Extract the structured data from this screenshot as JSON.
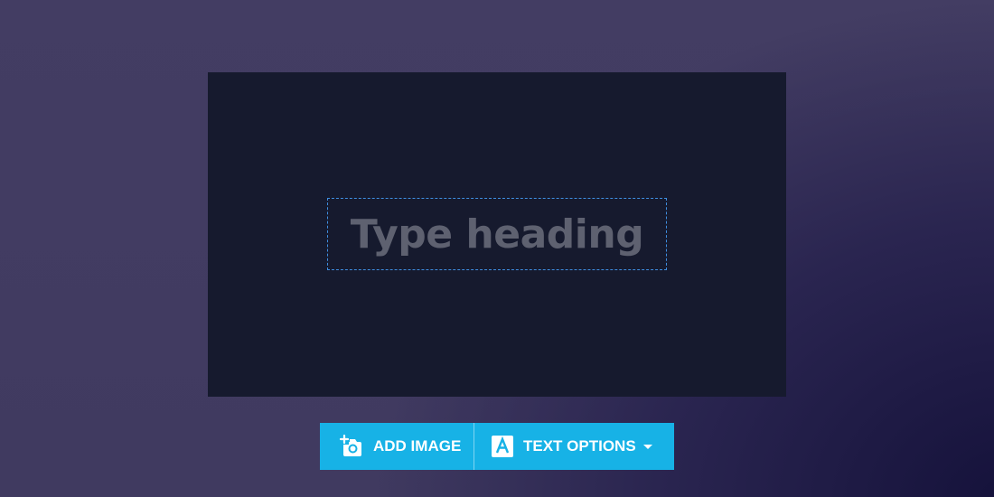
{
  "canvas": {
    "heading_placeholder": "Type heading"
  },
  "toolbar": {
    "add_image": {
      "label": "ADD IMAGE",
      "icon": "add-photo-icon"
    },
    "text_options": {
      "label": "TEXT OPTIONS",
      "icon": "text-a-icon",
      "dropdown_icon": "caret-down-icon"
    }
  },
  "colors": {
    "toolbar_background": "#17b2e6",
    "canvas_background": "#161a2e",
    "selection_border": "#3f8ee0",
    "placeholder_text": "#5e6170"
  }
}
